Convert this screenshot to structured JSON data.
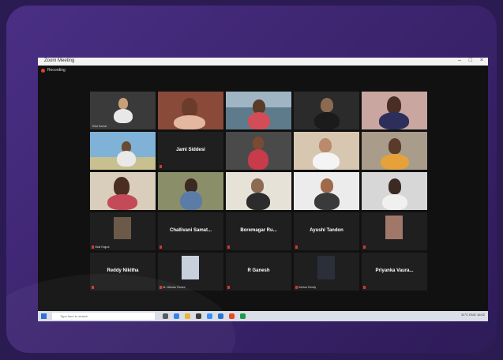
{
  "window": {
    "title": "Zoom Meeting",
    "recording_label": "Recording"
  },
  "tiles": [
    {
      "caption": "Ravi Kumar",
      "big": ""
    },
    {
      "caption": "",
      "big": ""
    },
    {
      "caption": "",
      "big": ""
    },
    {
      "caption": "",
      "big": ""
    },
    {
      "caption": "",
      "big": ""
    },
    {
      "caption": "",
      "big": ""
    },
    {
      "caption": "",
      "big": "Jami Siddesi"
    },
    {
      "caption": "",
      "big": ""
    },
    {
      "caption": "",
      "big": ""
    },
    {
      "caption": "",
      "big": ""
    },
    {
      "caption": "",
      "big": ""
    },
    {
      "caption": "",
      "big": ""
    },
    {
      "caption": "",
      "big": ""
    },
    {
      "caption": "",
      "big": ""
    },
    {
      "caption": "",
      "big": ""
    },
    {
      "caption": "Vikki Rajput",
      "big": ""
    },
    {
      "caption": "",
      "big": "Challivani Samat..."
    },
    {
      "caption": "",
      "big": "Boremagar Ru..."
    },
    {
      "caption": "",
      "big": "Ayushi Tandon"
    },
    {
      "caption": "",
      "big": ""
    },
    {
      "caption": "",
      "big": "Reddy Nikitha"
    },
    {
      "caption": "Dr. Mekala Pavani",
      "big": ""
    },
    {
      "caption": "",
      "big": "R Ganesh"
    },
    {
      "caption": "Sekhar Reddy",
      "big": ""
    },
    {
      "caption": "",
      "big": "Priyanka Vaura..."
    }
  ],
  "taskbar": {
    "search_placeholder": "Type here to search",
    "tray_text": "31°C  ENG  16:02"
  }
}
